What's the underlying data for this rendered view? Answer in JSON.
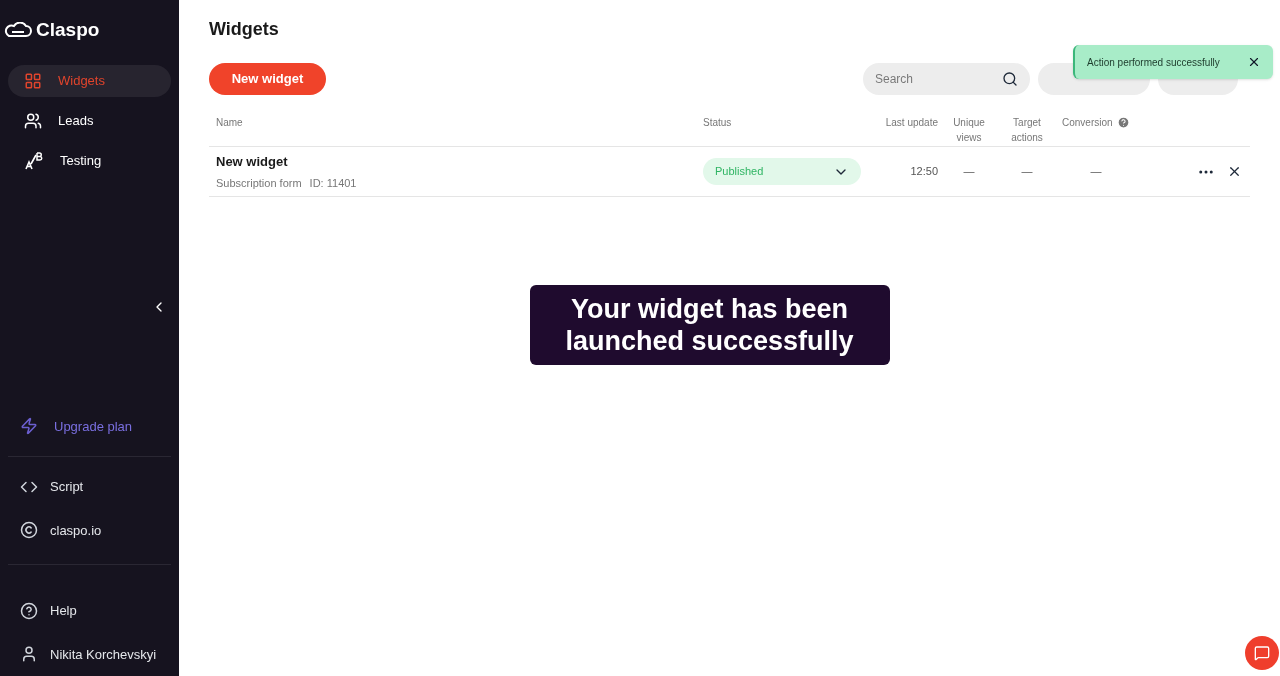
{
  "brand": "Claspo",
  "nav": [
    {
      "label": "Widgets",
      "kind": "grid",
      "selected": true
    },
    {
      "label": "Leads",
      "kind": "users",
      "selected": false
    },
    {
      "label": "Testing",
      "kind": "ab",
      "selected": false
    }
  ],
  "upgrade": "Upgrade plan",
  "links": [
    {
      "label": "Script",
      "kind": "code"
    },
    {
      "label": "claspo.io",
      "kind": "copyright"
    }
  ],
  "bottom_links": [
    {
      "label": "Help",
      "kind": "help"
    },
    {
      "label": "Nikita Korchevskyi",
      "kind": "user"
    }
  ],
  "page_title": "Widgets",
  "new_button": "New widget",
  "search": {
    "placeholder": "Search"
  },
  "table": {
    "columns": [
      "Name",
      "Status",
      "Last update",
      "Unique views",
      "Target actions",
      "Conversion"
    ],
    "rows": [
      {
        "name": "New widget",
        "type": "Subscription form",
        "id": "ID: 11401",
        "status": "Published",
        "last_update": "12:50",
        "unique_views": "—",
        "target_actions": "—",
        "conversion": "—"
      }
    ]
  },
  "toast": "Action performed successfully",
  "caption": "Your widget has been launched successfully"
}
